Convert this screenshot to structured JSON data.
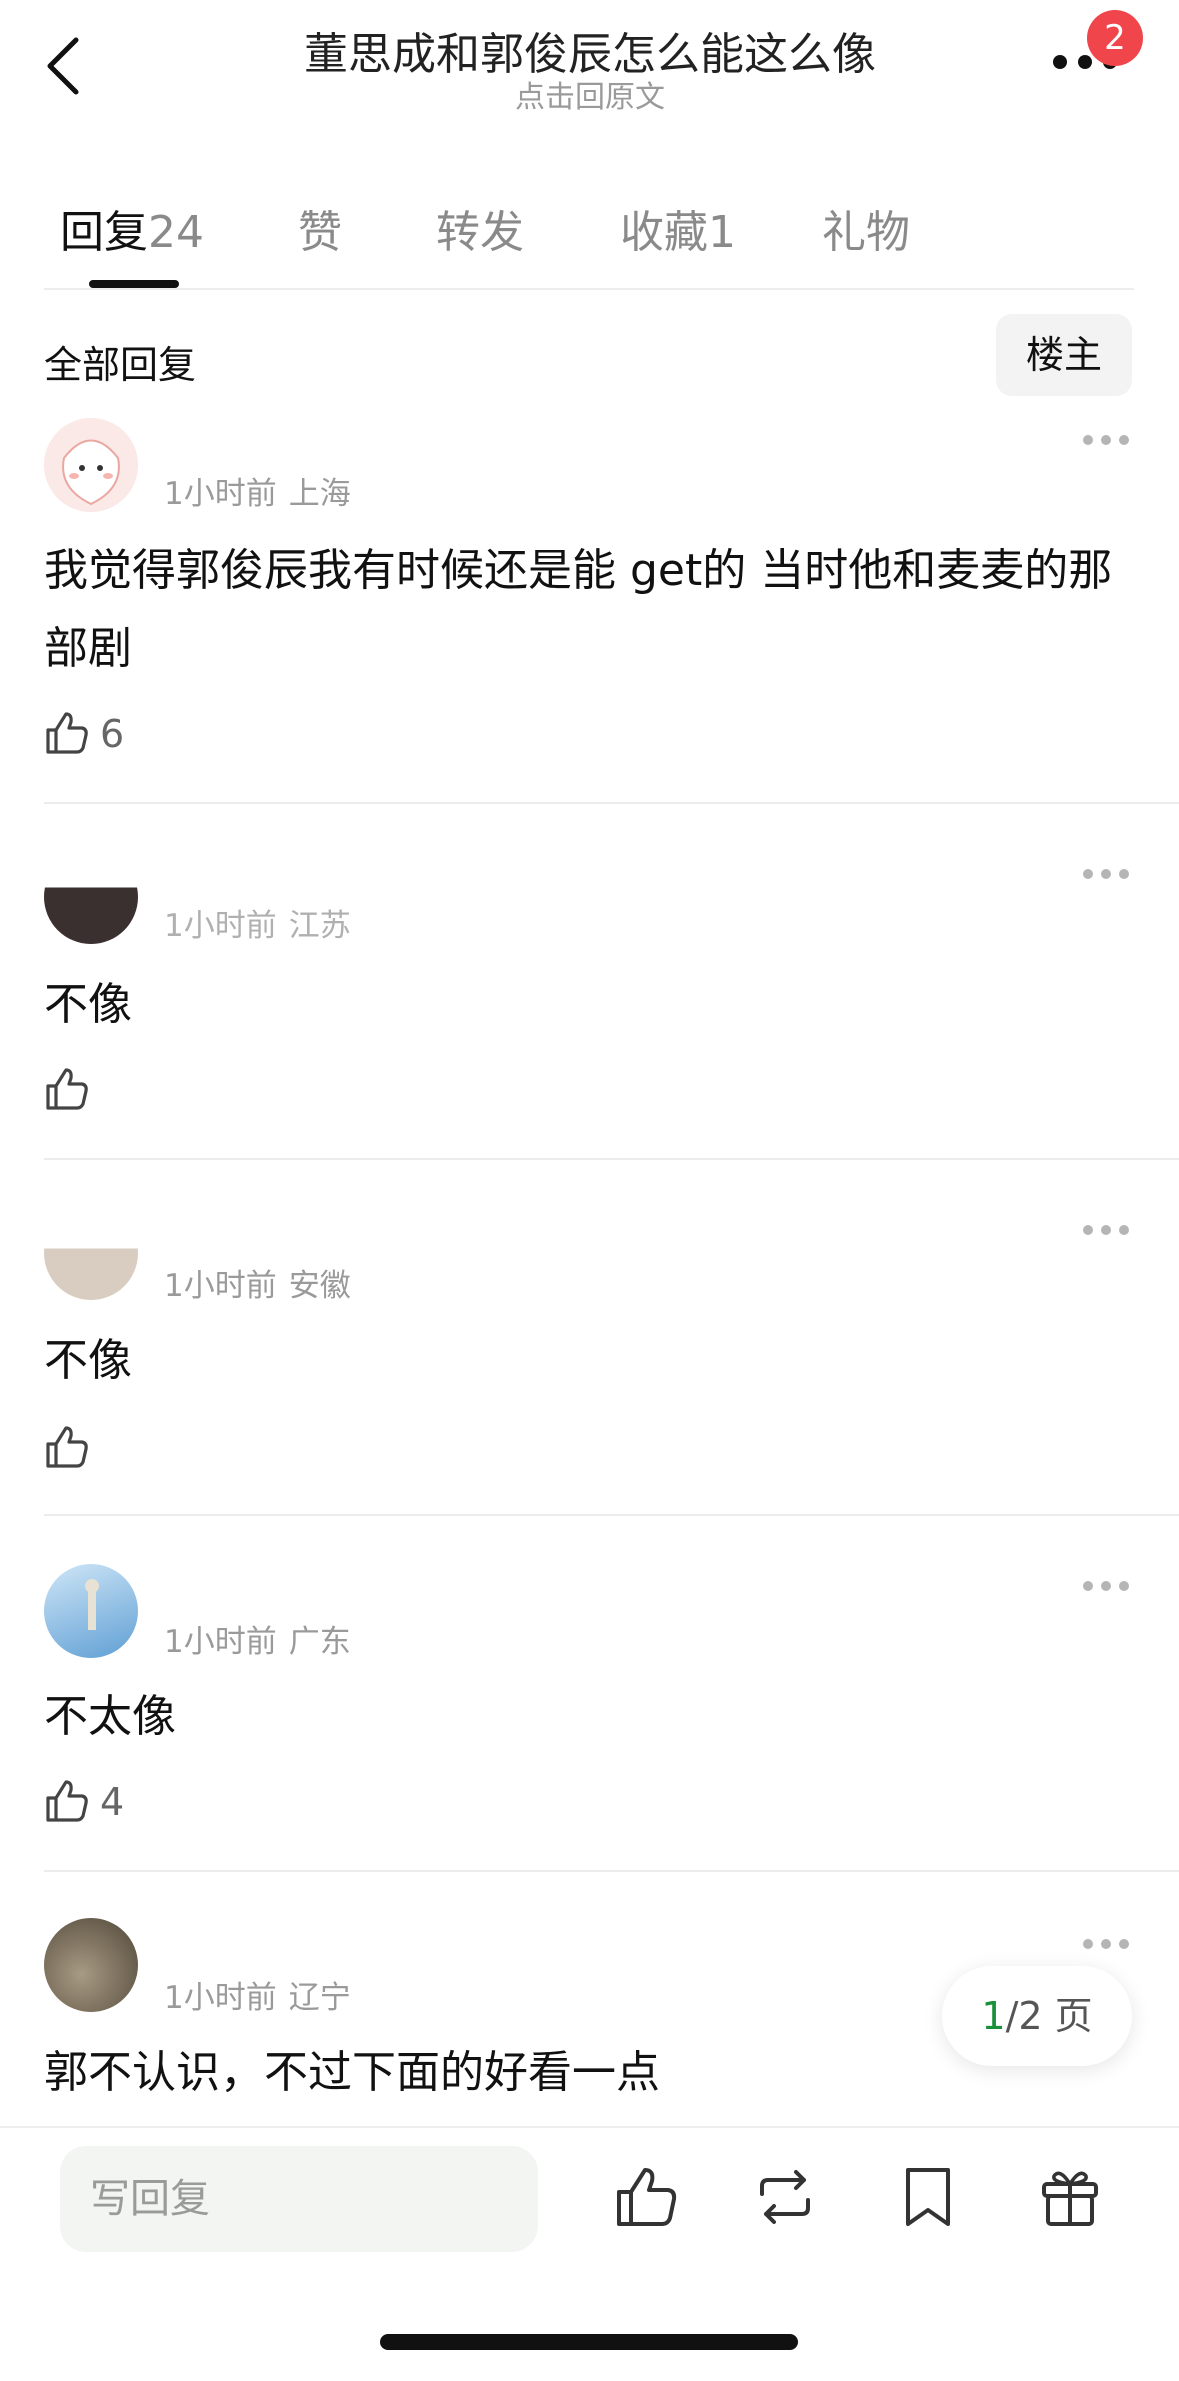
{
  "header": {
    "title": "董思成和郭俊辰怎么能这么像",
    "subtitle": "点击回原文",
    "badge_count": "2",
    "back_icon": "chevron-left-icon",
    "more_icon": "more-dots-icon"
  },
  "tabs": [
    {
      "label": "回复",
      "count": "24",
      "active": true
    },
    {
      "label": "赞",
      "count": "",
      "active": false
    },
    {
      "label": "转发",
      "count": "",
      "active": false
    },
    {
      "label": "收藏",
      "count": "1",
      "active": false
    },
    {
      "label": "礼物",
      "count": "",
      "active": false
    }
  ],
  "section": {
    "title": "全部回复",
    "filter_button": "楼主"
  },
  "comments": [
    {
      "time": "1小时前",
      "location": "上海",
      "text": "我觉得郭俊辰我有时候还是能 get的 当时他和麦麦的那部剧",
      "likes": "6"
    },
    {
      "time": "1小时前",
      "location": "江苏",
      "text": "不像",
      "likes": ""
    },
    {
      "time": "1小时前",
      "location": "安徽",
      "text": "不像",
      "likes": ""
    },
    {
      "time": "1小时前",
      "location": "广东",
      "text": "不太像",
      "likes": "4"
    },
    {
      "time": "1小时前",
      "location": "辽宁",
      "text": "郭不认识，不过下面的好看一点",
      "likes": ""
    }
  ],
  "pagination": {
    "current": "1",
    "total_label": "/2 页"
  },
  "bottom_bar": {
    "reply_placeholder": "写回复",
    "icons": [
      "thumbs-up-icon",
      "repost-icon",
      "bookmark-icon",
      "gift-icon"
    ]
  },
  "colors": {
    "accent_green": "#1a8f3c",
    "badge_red": "#f0454b"
  }
}
